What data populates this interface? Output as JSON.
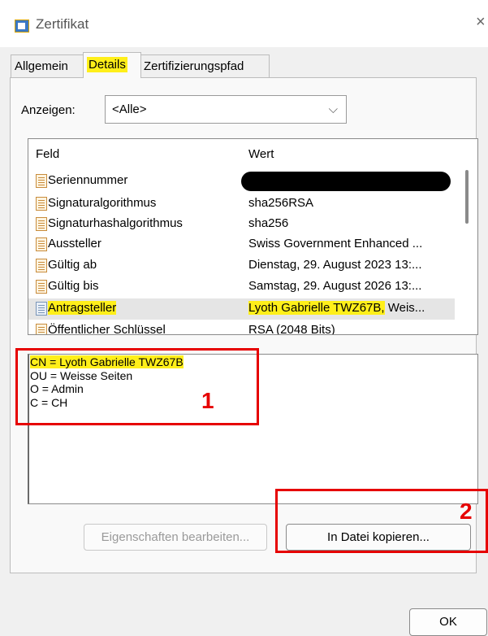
{
  "window": {
    "title": "Zertifikat",
    "close_glyph": "×",
    "icon": "certificate-icon"
  },
  "tabs": [
    {
      "label": "Allgemein",
      "active": false
    },
    {
      "label": "Details",
      "active": true
    },
    {
      "label": "Zertifizierungspfad",
      "active": false
    }
  ],
  "show": {
    "label": "Anzeigen:",
    "selected": "<Alle>"
  },
  "list": {
    "columns": {
      "field": "Feld",
      "value": "Wert"
    },
    "rows": [
      {
        "field": "Seriennummer",
        "value": ""
      },
      {
        "field": "Signaturalgorithmus",
        "value": "sha256RSA"
      },
      {
        "field": "Signaturhashalgorithmus",
        "value": "sha256"
      },
      {
        "field": "Aussteller",
        "value": "Swiss Government Enhanced ..."
      },
      {
        "field": "Gültig ab",
        "value": "Dienstag, 29. August 2023 13:..."
      },
      {
        "field": "Gültig bis",
        "value": "Samstag, 29. August 2026 13:..."
      },
      {
        "field": "Antragsteller",
        "value_highlight": "Lyoth Gabrielle TWZ67B,",
        "value_rest": " Weis..."
      },
      {
        "field": "Öffentlicher Schlüssel",
        "value": "RSA (2048 Bits)"
      }
    ]
  },
  "detail": {
    "lines": [
      "CN = Lyoth Gabrielle TWZ67B",
      "OU = Weisse Seiten",
      "O = Admin",
      "C = CH"
    ]
  },
  "annotations": {
    "one": "1",
    "two": "2"
  },
  "buttons": {
    "edit_properties": "Eigenschaften bearbeiten...",
    "copy_to_file": "In Datei kopieren...",
    "ok": "OK"
  },
  "colors": {
    "highlight": "#ffef1a",
    "annotation_red": "#e60000"
  }
}
